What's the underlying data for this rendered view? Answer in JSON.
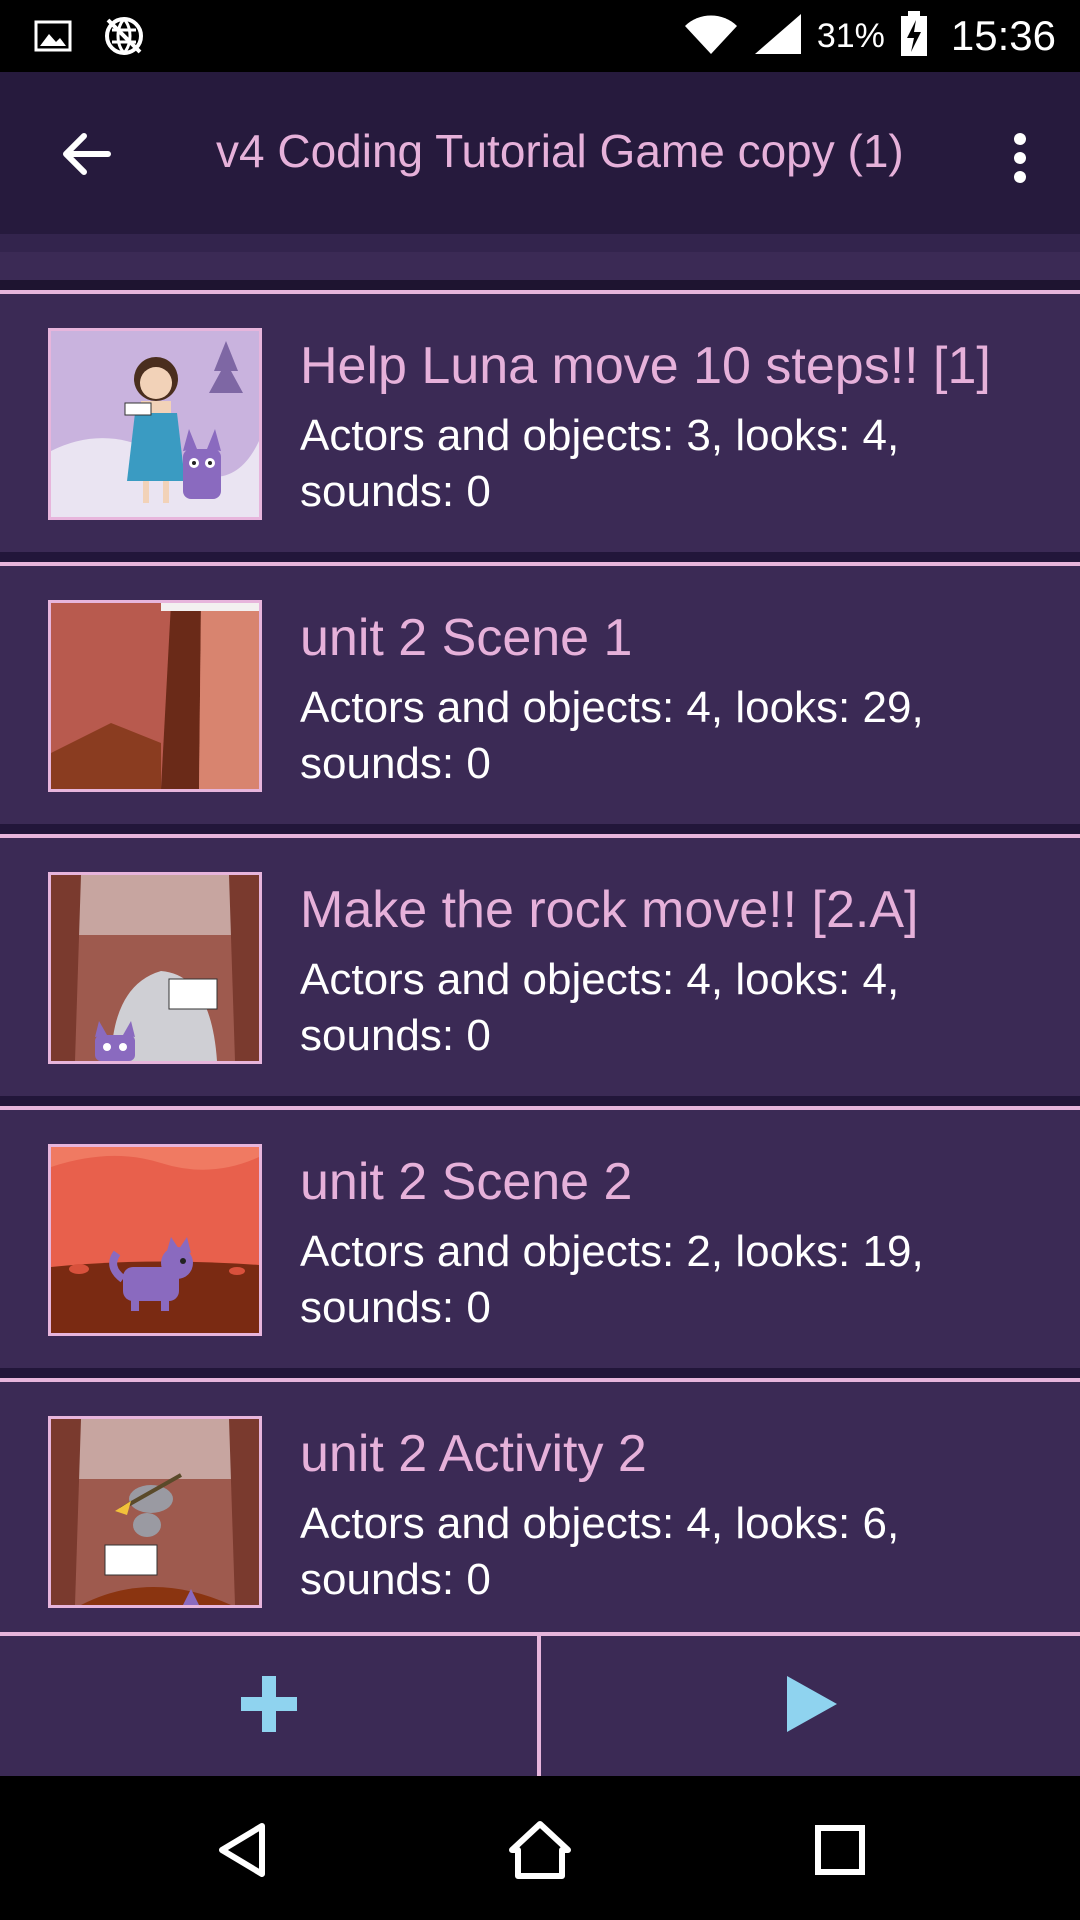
{
  "status_bar": {
    "battery_percent": "31%",
    "time": "15:36",
    "icons": [
      "image-icon",
      "sync-off-icon",
      "wifi-icon",
      "signal-icon",
      "battery-charging-icon"
    ]
  },
  "app_bar": {
    "title": "v4 Coding Tutorial Game copy (1)",
    "back_icon": "arrow-back-icon",
    "menu_icon": "more-vert-icon"
  },
  "scenes": [
    {
      "title": "Help Luna move 10 steps!! [1]",
      "description": "Actors and objects: 3, looks: 4, sounds: 0"
    },
    {
      "title": "unit 2 Scene 1",
      "description": "Actors and objects: 4, looks: 29, sounds: 0"
    },
    {
      "title": "Make the rock move!! [2.A]",
      "description": "Actors and objects: 4, looks: 4, sounds: 0"
    },
    {
      "title": "unit 2 Scene 2",
      "description": "Actors and objects: 2, looks: 19, sounds: 0"
    },
    {
      "title": "unit 2 Activity 2",
      "description": "Actors and objects: 4, looks: 6, sounds: 0"
    }
  ],
  "bottom_bar": {
    "add_icon": "plus-icon",
    "play_icon": "play-icon"
  },
  "colors": {
    "background": "#3b2a55",
    "app_bar": "#261a3d",
    "accent_pink": "#e6b1da",
    "icon_blue": "#8fd3ef"
  }
}
